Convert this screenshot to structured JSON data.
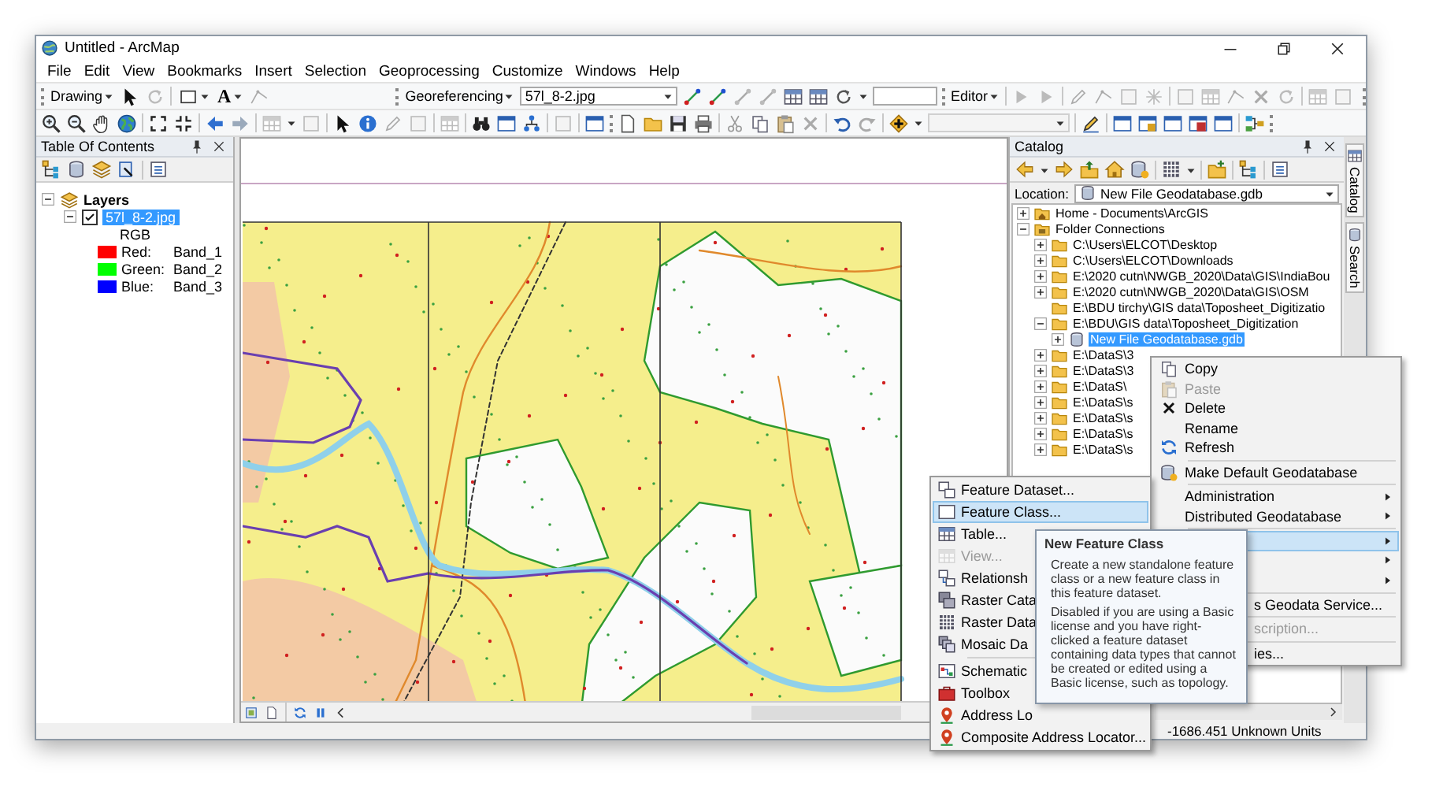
{
  "window": {
    "title": "Untitled - ArcMap"
  },
  "menu_bar": [
    "File",
    "Edit",
    "View",
    "Bookmarks",
    "Insert",
    "Selection",
    "Geoprocessing",
    "Customize",
    "Windows",
    "Help"
  ],
  "toolbars": {
    "drawing": {
      "label": "Drawing",
      "text_tool": "A"
    },
    "georeferencing": {
      "label": "Georeferencing",
      "layer": "57l_8-2.jpg"
    },
    "editor": {
      "label": "Editor"
    }
  },
  "table_of_contents": {
    "title": "Table Of Contents",
    "root": {
      "label": "Layers",
      "expanded": true
    },
    "layers": [
      {
        "name": "57l_8-2.jpg",
        "checked": true,
        "selected": true,
        "expanded": true,
        "renderer": "RGB",
        "bands": [
          {
            "channel": "Red:",
            "band": "Band_1",
            "color": "#ff0000"
          },
          {
            "channel": "Green:",
            "band": "Band_2",
            "color": "#00ff00"
          },
          {
            "channel": "Blue:",
            "band": "Band_3",
            "color": "#0000ff"
          }
        ]
      }
    ]
  },
  "catalog": {
    "title": "Catalog",
    "location_label": "Location:",
    "location": "New File Geodatabase.gdb",
    "tree": [
      {
        "kind": "home",
        "label": "Home - Documents\\ArcGIS",
        "expanded": false,
        "selected": false
      },
      {
        "kind": "connections",
        "label": "Folder Connections",
        "expanded": true,
        "selected": false,
        "children": [
          {
            "kind": "folder",
            "label": "C:\\Users\\ELCOT\\Desktop",
            "expanded": false,
            "selected": false
          },
          {
            "kind": "folder",
            "label": "C:\\Users\\ELCOT\\Downloads",
            "expanded": false,
            "selected": false
          },
          {
            "kind": "folder",
            "label": "E:\\2020 cutn\\NWGB_2020\\Data\\GIS\\IndiaBou",
            "expanded": false,
            "selected": false
          },
          {
            "kind": "folder",
            "label": "E:\\2020 cutn\\NWGB_2020\\Data\\GIS\\OSM",
            "expanded": false,
            "selected": false
          },
          {
            "kind": "folder",
            "label": "E:\\BDU tirchy\\GIS data\\Toposheet_Digitizatio",
            "selected": false
          },
          {
            "kind": "folder",
            "label": "E:\\BDU\\GIS data\\Toposheet_Digitization",
            "expanded": true,
            "selected": false,
            "children": [
              {
                "kind": "geodatabase",
                "label": "New File Geodatabase.gdb",
                "expanded": false,
                "selected": true
              }
            ]
          },
          {
            "kind": "folder",
            "label": "E:\\DataS\\3",
            "expanded": false,
            "selected": false
          },
          {
            "kind": "folder",
            "label": "E:\\DataS\\3",
            "expanded": false,
            "selected": false
          },
          {
            "kind": "folder",
            "label": "E:\\DataS\\",
            "expanded": false,
            "selected": false
          },
          {
            "kind": "folder",
            "label": "E:\\DataS\\s",
            "expanded": false,
            "selected": false
          },
          {
            "kind": "folder",
            "label": "E:\\DataS\\s",
            "expanded": false,
            "selected": false
          },
          {
            "kind": "folder",
            "label": "E:\\DataS\\s",
            "expanded": false,
            "selected": false
          },
          {
            "kind": "folder",
            "label": "E:\\DataS\\s",
            "expanded": false,
            "selected": false
          }
        ]
      }
    ]
  },
  "side_tabs": [
    {
      "label": "Catalog"
    },
    {
      "label": "Search"
    }
  ],
  "context_menu": {
    "items": [
      {
        "kind": "command",
        "label": "Copy",
        "disabled": false,
        "selected": false
      },
      {
        "kind": "command",
        "label": "Paste",
        "disabled": true,
        "selected": false
      },
      {
        "kind": "command",
        "label": "Delete",
        "disabled": false,
        "selected": false
      },
      {
        "kind": "command",
        "label": "Rename",
        "disabled": false,
        "selected": false
      },
      {
        "kind": "command",
        "label": "Refresh",
        "disabled": false,
        "selected": false
      },
      {
        "kind": "separator"
      },
      {
        "kind": "command",
        "label": "Make Default Geodatabase",
        "disabled": false,
        "selected": false
      },
      {
        "kind": "separator"
      },
      {
        "kind": "submenu",
        "label": "Administration",
        "disabled": false,
        "selected": false
      },
      {
        "kind": "submenu",
        "label": "Distributed Geodatabase",
        "disabled": false,
        "selected": false
      },
      {
        "kind": "separator"
      },
      {
        "kind": "submenu",
        "selected": true
      },
      {
        "kind": "submenu",
        "selected": false
      },
      {
        "kind": "submenu",
        "selected": false
      },
      {
        "kind": "separator"
      },
      {
        "kind": "command",
        "label": "s Geodata Service...",
        "disabled": false,
        "selected": false,
        "covered": true
      },
      {
        "kind": "separator"
      },
      {
        "kind": "command",
        "label": "scription...",
        "disabled": true,
        "selected": false,
        "covered": true
      },
      {
        "kind": "separator"
      },
      {
        "kind": "command",
        "label": "ies...",
        "disabled": false,
        "selected": false,
        "covered": true
      }
    ]
  },
  "submenu": {
    "items": [
      {
        "kind": "command",
        "label": "Feature Dataset...",
        "disabled": false,
        "selected": false
      },
      {
        "kind": "command",
        "label": "Feature Class...",
        "disabled": false,
        "selected": true
      },
      {
        "kind": "command",
        "label": "Table...",
        "disabled": false,
        "selected": false
      },
      {
        "kind": "command",
        "label": "View...",
        "disabled": true,
        "selected": false
      },
      {
        "kind": "command",
        "label": "Relationsh",
        "disabled": false,
        "selected": false
      },
      {
        "kind": "command",
        "label": "Raster Cata",
        "disabled": false,
        "selected": false
      },
      {
        "kind": "command",
        "label": "Raster Data",
        "disabled": false,
        "selected": false
      },
      {
        "kind": "command",
        "label": "Mosaic Da",
        "disabled": false,
        "selected": false
      },
      {
        "kind": "separator"
      },
      {
        "kind": "command",
        "label": "Schematic",
        "disabled": false,
        "selected": false
      },
      {
        "kind": "command",
        "label": "Toolbox",
        "disabled": false,
        "selected": false
      },
      {
        "kind": "command",
        "label": "Address Lo",
        "disabled": false,
        "selected": false
      },
      {
        "kind": "command",
        "label": "Composite Address Locator...",
        "disabled": false,
        "selected": false
      }
    ]
  },
  "tooltip": {
    "title": "New Feature Class",
    "paragraphs": [
      "Create a new standalone feature class or a new feature class in this feature dataset.",
      "Disabled if you are using a Basic license and you have right-clicked a feature dataset containing data types that cannot be created or edited using a Basic license, such as topology."
    ]
  },
  "status_bar": {
    "coordinates": "-1686.451 Unknown Units"
  }
}
